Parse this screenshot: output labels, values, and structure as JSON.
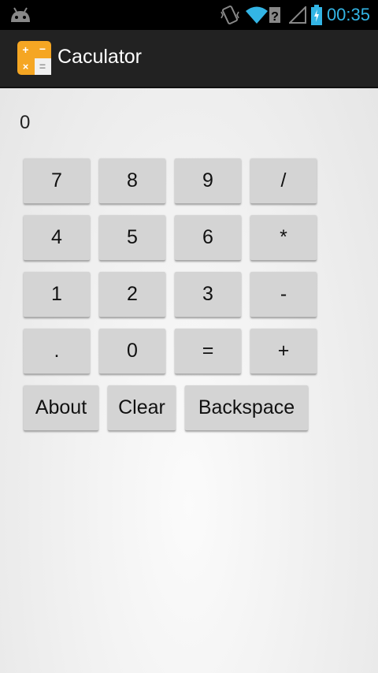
{
  "app": {
    "title": "Caculator"
  },
  "status_bar": {
    "time": "00:35",
    "accent": "#33b5e5"
  },
  "display": {
    "value": "0"
  },
  "keys": {
    "k7": "7",
    "k8": "8",
    "k9": "9",
    "div": "/",
    "k4": "4",
    "k5": "5",
    "k6": "6",
    "mul": "*",
    "k1": "1",
    "k2": "2",
    "k3": "3",
    "sub": "-",
    "dot": ".",
    "k0": "0",
    "eq": "=",
    "add": "+"
  },
  "actions": {
    "about": "About",
    "clear": "Clear",
    "backspace": "Backspace"
  },
  "icons": [
    "android-icon",
    "vibrate-icon",
    "wifi-icon",
    "signal-icon",
    "battery-icon",
    "calculator-app-icon"
  ]
}
